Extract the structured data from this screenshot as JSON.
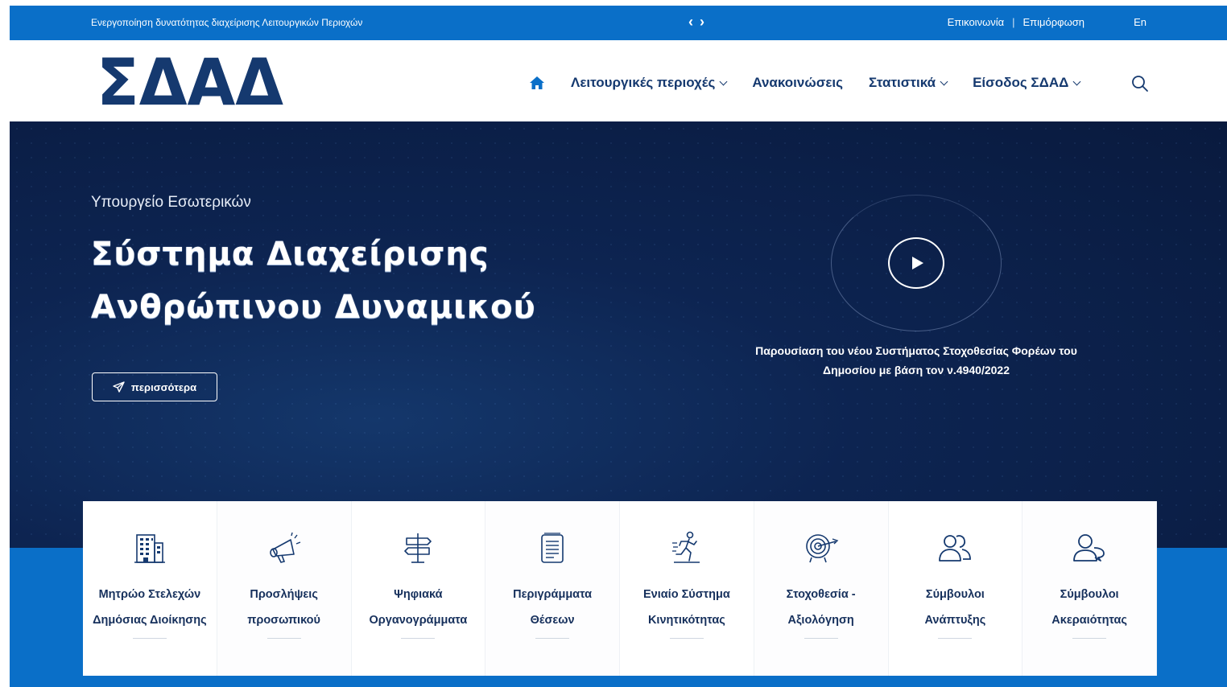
{
  "topbar": {
    "ticker": "Ενεργοποίηση δυνατότητας διαχείρισης Λειτουργικών Περιοχών",
    "prev": "‹",
    "next": "›",
    "contact": "Επικοινωνία",
    "separator": "|",
    "training": "Επιμόρφωση",
    "lang": "En"
  },
  "header": {
    "logo_text": "ΣΔΑΔ",
    "nav": {
      "functional_areas": "Λειτουργικές περιοχές",
      "announcements": "Ανακοινώσεις",
      "statistics": "Στατιστικά",
      "login": "Είσοδος ΣΔΑΔ"
    }
  },
  "hero": {
    "subtitle": "Υπουργείο Εσωτερικών",
    "title_line1": "Σύστημα Διαχείρισης",
    "title_line2": "Ανθρώπινου Δυναμικού",
    "more_button": "περισσότερα",
    "video_caption": "Παρουσίαση του νέου Συστήματος Στοχοθεσίας Φορέων του Δημοσίου με βάση τον ν.4940/2022"
  },
  "cards": [
    {
      "icon": "building-icon",
      "line1": "Μητρώο Στελεχών",
      "line2": "Δημόσιας Διοίκησης"
    },
    {
      "icon": "megaphone-icon",
      "line1": "Προσλήψεις",
      "line2": "προσωπικού"
    },
    {
      "icon": "signpost-icon",
      "line1": "Ψηφιακά",
      "line2": "Οργανογράμματα"
    },
    {
      "icon": "document-icon",
      "line1": "Περιγράμματα",
      "line2": "Θέσεων"
    },
    {
      "icon": "runner-icon",
      "line1": "Ενιαίο Σύστημα",
      "line2": "Κινητικότητας"
    },
    {
      "icon": "target-icon",
      "line1": "Στοχοθεσία -",
      "line2": "Αξιολόγηση"
    },
    {
      "icon": "users-icon",
      "line1": "Σύμβουλοι",
      "line2": "Ανάπτυξης"
    },
    {
      "icon": "user-chat-icon",
      "line1": "Σύμβουλοι",
      "line2": "Ακεραιότητας"
    }
  ],
  "colors": {
    "topbar": "#0a6fc8",
    "navy": "#15396f",
    "hero_dark": "#091a3e"
  }
}
